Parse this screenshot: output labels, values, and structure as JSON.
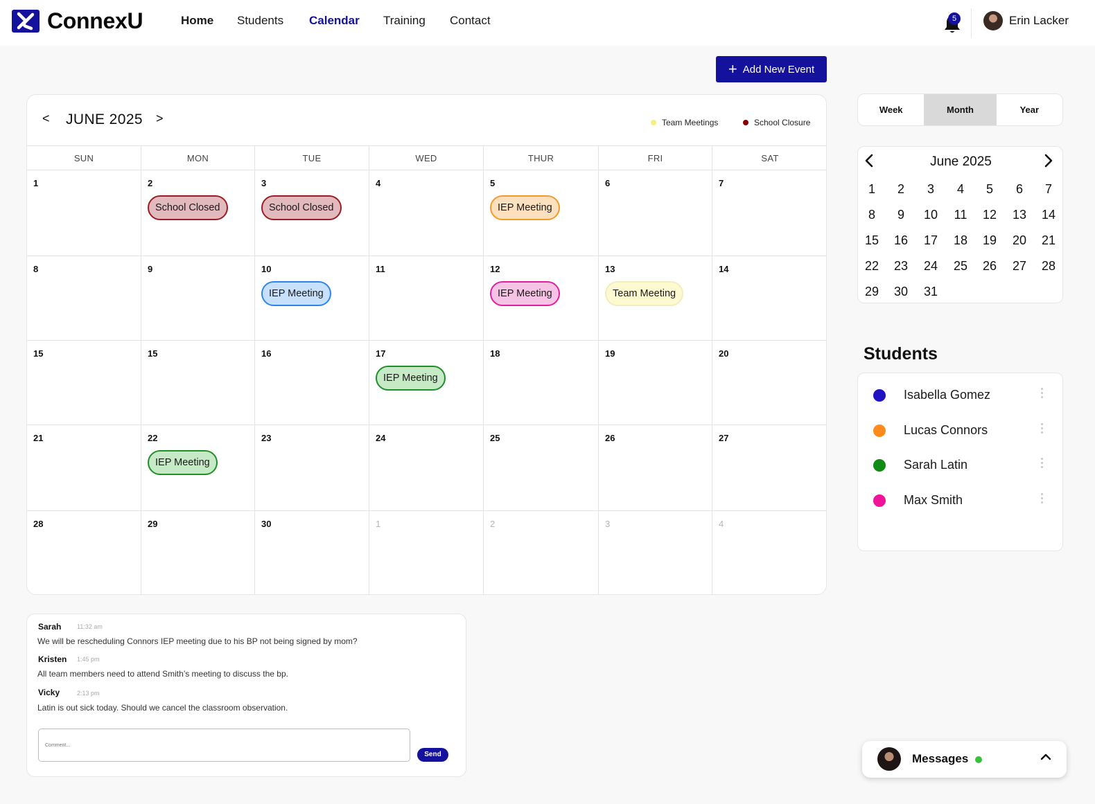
{
  "brand": {
    "name": "ConnexU",
    "accent": "#14129c"
  },
  "nav": [
    {
      "label": "Home"
    },
    {
      "label": "Students"
    },
    {
      "label": "Calendar"
    },
    {
      "label": "Training"
    },
    {
      "label": "Contact"
    }
  ],
  "header": {
    "notification_count": "5",
    "user_name": "Erin Lacker"
  },
  "add_event_label": "Add New Event",
  "calendar": {
    "title": "JUNE 2025",
    "prev": "<",
    "next": ">",
    "legend": [
      {
        "label": "Team Meetings",
        "color": "#f6ef7e"
      },
      {
        "label": "School Closure",
        "color": "#8b0000"
      }
    ],
    "weekdays": [
      "SUN",
      "MON",
      "TUE",
      "WED",
      "THUR",
      "FRI",
      "SAT"
    ],
    "weeks": [
      [
        {
          "day": "1"
        },
        {
          "day": "2",
          "event": "School Closed",
          "kind": "closure"
        },
        {
          "day": "3",
          "event": "School Closed",
          "kind": "closure"
        },
        {
          "day": "4"
        },
        {
          "day": "5",
          "event": "IEP Meeting",
          "kind": "orange"
        },
        {
          "day": "6"
        },
        {
          "day": "7"
        }
      ],
      [
        {
          "day": "8"
        },
        {
          "day": "9"
        },
        {
          "day": "10",
          "event": "IEP Meeting",
          "kind": "blue"
        },
        {
          "day": "11"
        },
        {
          "day": "12",
          "event": "IEP Meeting",
          "kind": "pink"
        },
        {
          "day": "13",
          "event": "Team Meeting",
          "kind": "team"
        },
        {
          "day": "14"
        }
      ],
      [
        {
          "day": "15"
        },
        {
          "day": "15"
        },
        {
          "day": "16"
        },
        {
          "day": "17",
          "event": "IEP Meeting",
          "kind": "green"
        },
        {
          "day": "18"
        },
        {
          "day": "19"
        },
        {
          "day": "20"
        }
      ],
      [
        {
          "day": "21"
        },
        {
          "day": "22",
          "event": "IEP Meeting",
          "kind": "green"
        },
        {
          "day": "23"
        },
        {
          "day": "24"
        },
        {
          "day": "25"
        },
        {
          "day": "26"
        },
        {
          "day": "27"
        }
      ],
      [
        {
          "day": "28"
        },
        {
          "day": "29"
        },
        {
          "day": "30"
        },
        {
          "day": "1",
          "muted": true
        },
        {
          "day": "2",
          "muted": true
        },
        {
          "day": "3",
          "muted": true
        },
        {
          "day": "4",
          "muted": true
        }
      ]
    ]
  },
  "view_switch": {
    "options": [
      "Week",
      "Month",
      "Year"
    ],
    "selected": "Month"
  },
  "mini_calendar": {
    "title": "June 2025",
    "days": [
      "1",
      "2",
      "3",
      "4",
      "5",
      "6",
      "7",
      "8",
      "9",
      "10",
      "11",
      "12",
      "13",
      "14",
      "15",
      "16",
      "17",
      "18",
      "19",
      "20",
      "21",
      "22",
      "23",
      "24",
      "25",
      "26",
      "27",
      "28",
      "29",
      "30",
      "31"
    ]
  },
  "students": {
    "heading": "Students",
    "list": [
      {
        "name": "Isabella Gomez",
        "color": "#1f13c4"
      },
      {
        "name": "Lucas Connors",
        "color": "#ff8c1a"
      },
      {
        "name": "Sarah Latin",
        "color": "#0f8a12"
      },
      {
        "name": "Max Smith",
        "color": "#f0139a"
      }
    ]
  },
  "comments": {
    "items": [
      {
        "author": "Sarah",
        "time": "11:32 am",
        "text": "We will be rescheduling Connors IEP meeting due to his BP not being signed by mom?"
      },
      {
        "author": "Kristen",
        "time": "1:45 pm",
        "text": "All team members need to attend Smith’s meeting to discuss the bp."
      },
      {
        "author": "Vicky",
        "time": "2:13 pm",
        "text": "Latin is out sick today. Should we cancel the classroom observation."
      }
    ],
    "placeholder": "Comment...",
    "send_label": "Send"
  },
  "messages": {
    "label": "Messages"
  },
  "pill_styles": {
    "closure": {
      "bg": "#e2b9bd",
      "border": "#9b1c22"
    },
    "orange": {
      "bg": "#fde0bd",
      "border": "#f39a2b"
    },
    "blue": {
      "bg": "#c8e0fb",
      "border": "#2a86e8"
    },
    "pink": {
      "bg": "#f6c3e5",
      "border": "#e0209c"
    },
    "team": {
      "bg": "#fdf9d1",
      "border": "#f3ecbd"
    },
    "green": {
      "bg": "#c6e9c6",
      "border": "#1f8f2a"
    }
  }
}
